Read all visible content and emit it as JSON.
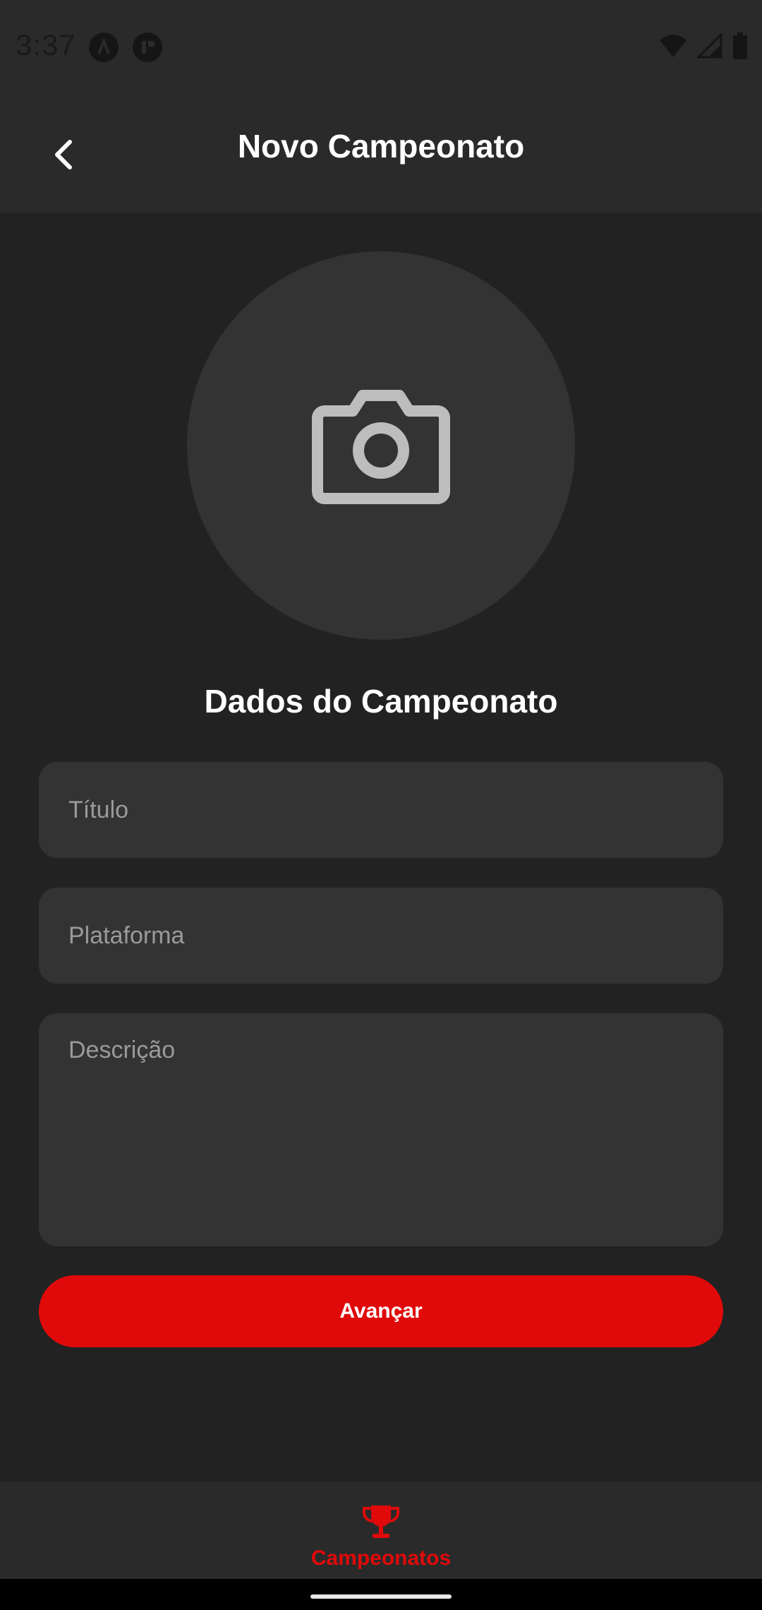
{
  "status_bar": {
    "time": "3:37",
    "icons": [
      "app-notification-icon",
      "app-notification-icon-2",
      "wifi-icon",
      "signal-icon",
      "battery-icon"
    ]
  },
  "header": {
    "back_icon": "chevron-left-icon",
    "title": "Novo Campeonato"
  },
  "photo_picker": {
    "icon": "camera-icon"
  },
  "form": {
    "section_title": "Dados do Campeonato",
    "title_field": {
      "placeholder": "Título",
      "value": ""
    },
    "platform_field": {
      "placeholder": "Plataforma",
      "value": ""
    },
    "description_field": {
      "placeholder": "Descrição",
      "value": ""
    },
    "submit_label": "Avançar"
  },
  "bottom_nav": {
    "items": [
      {
        "label": "Campeonatos",
        "icon": "trophy-icon",
        "active": true
      }
    ]
  },
  "colors": {
    "accent": "#e00a0a",
    "background": "#222222",
    "surface": "#333333",
    "header": "#2a2a2a"
  }
}
